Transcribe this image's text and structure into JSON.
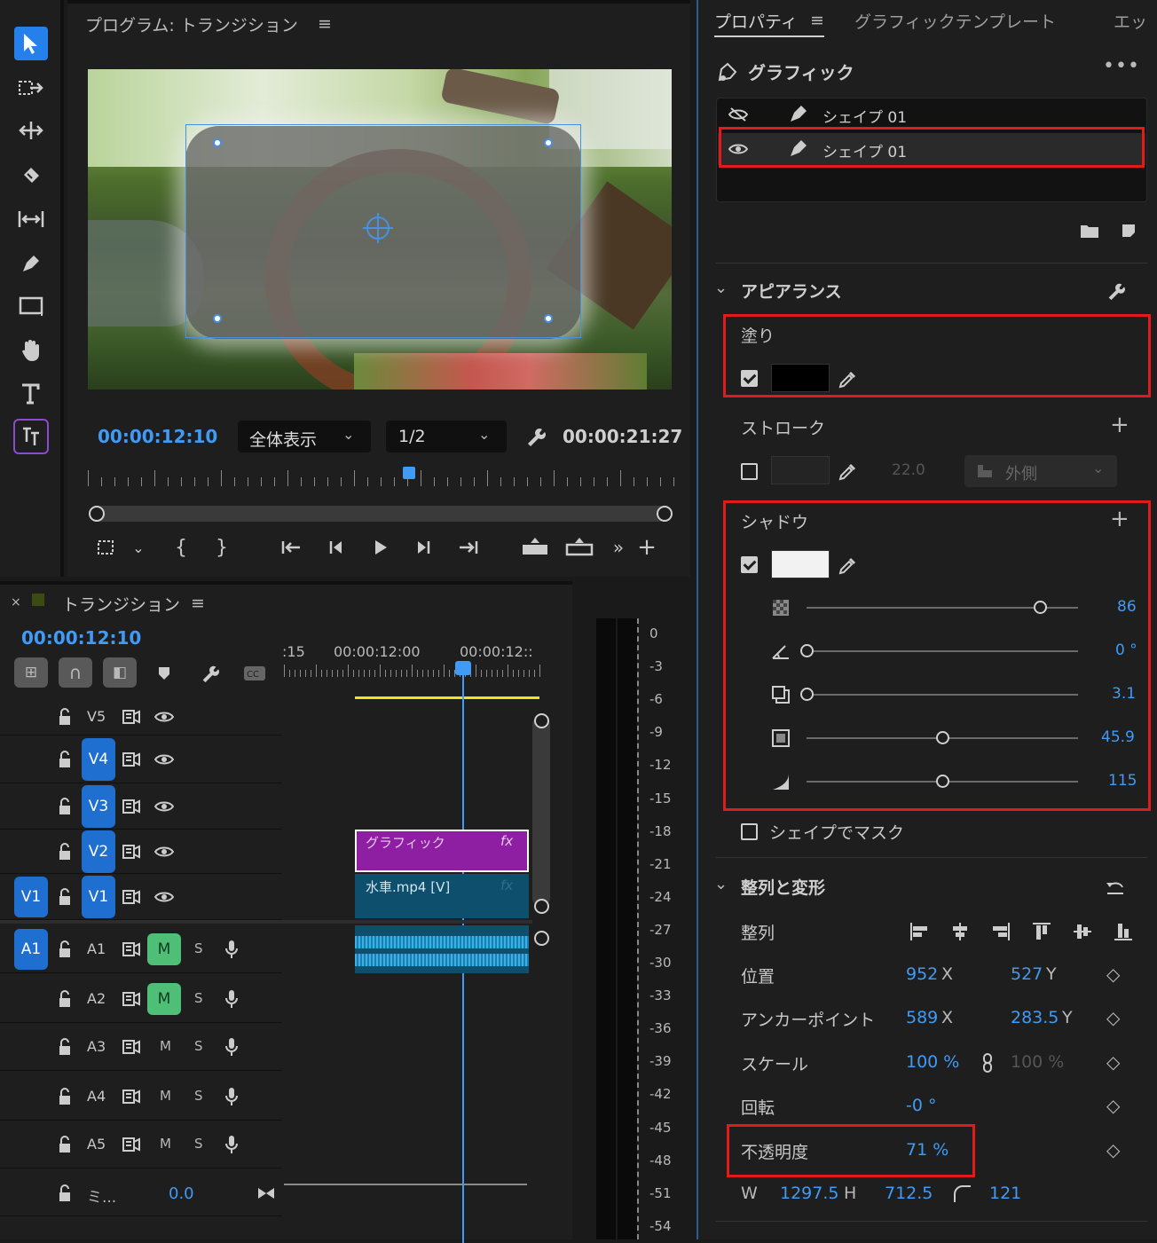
{
  "program": {
    "title": "プログラム: トランジション",
    "timecode": "00:00:12:10",
    "fit": "全体表示",
    "resolution": "1/2",
    "duration": "00:00:21:27",
    "position": 0.55
  },
  "timeline": {
    "title": "トランジション",
    "timecode": "00:00:12:10",
    "ruler": [
      ":15",
      "00:00:12:00",
      "00:00:12::"
    ],
    "tracks_video": [
      {
        "name": "V5",
        "src": ""
      },
      {
        "name": "V4",
        "src": ""
      },
      {
        "name": "V3",
        "src": ""
      },
      {
        "name": "V2",
        "src": ""
      },
      {
        "name": "V1",
        "src": "V1"
      }
    ],
    "tracks_audio": [
      {
        "name": "A1",
        "src": "A1",
        "m": "M",
        "s": "S",
        "m_on": true
      },
      {
        "name": "A2",
        "src": "",
        "m": "M",
        "s": "S",
        "m_on": true
      },
      {
        "name": "A3",
        "src": "",
        "m": "M",
        "s": "S",
        "m_on": false
      },
      {
        "name": "A4",
        "src": "",
        "m": "M",
        "s": "S",
        "m_on": false
      },
      {
        "name": "A5",
        "src": "",
        "m": "M",
        "s": "S",
        "m_on": false
      }
    ],
    "mix_label": "ミ...",
    "mix_value": "0.0",
    "clip_graphic": "グラフィック",
    "clip_video": "水車.mp4 [V]",
    "fx": "fx"
  },
  "meter": {
    "labels": [
      "0",
      "-3",
      "-6",
      "-9",
      "-12",
      "-15",
      "-18",
      "-21",
      "-24",
      "-27",
      "-30",
      "-33",
      "-36",
      "-39",
      "-42",
      "-45",
      "-48",
      "-51",
      "-54"
    ]
  },
  "properties": {
    "tabs": [
      "プロパティ",
      "グラフィックテンプレート",
      "エッ"
    ],
    "graphic_title": "グラフィック",
    "layers": [
      "シェイプ 01",
      "シェイプ 01"
    ],
    "appearance": "アピアランス",
    "fill": {
      "label": "塗り",
      "color": "#000000",
      "checked": true
    },
    "stroke": {
      "label": "ストローク",
      "width": "22.0",
      "position": "外側",
      "checked": false
    },
    "shadow": {
      "label": "シャドウ",
      "color": "#f2f2f2",
      "checked": true,
      "opacity": "86",
      "angle": "0 °",
      "distance": "3.1",
      "size": "45.9",
      "blur": "115",
      "opacity_pos": 0.86,
      "angle_pos": 0.0,
      "distance_pos": 0.0,
      "size_pos": 0.5,
      "blur_pos": 0.5
    },
    "mask_label": "シェイプでマスク",
    "align_title": "整列と変形",
    "align_label": "整列",
    "position_label": "位置",
    "pos_x": "952",
    "pos_y": "527",
    "anchor_label": "アンカーポイント",
    "anchor_x": "589",
    "anchor_y": "283.5",
    "scale_label": "スケール",
    "scale": "100 %",
    "scale2": "100 %",
    "rotation_label": "回転",
    "rotation": "-0 °",
    "opacity_label": "不透明度",
    "opacity": "71 %",
    "w_label": "W",
    "w": "1297.5",
    "h_label": "H",
    "h": "712.5",
    "corner": "121",
    "x_unit": "X",
    "y_unit": "Y"
  },
  "colors": {
    "accent": "#3f9bf6",
    "highlight": "#e21a1a",
    "graphic_clip": "#8e1fa3",
    "video_clip": "#0e4f6d"
  }
}
